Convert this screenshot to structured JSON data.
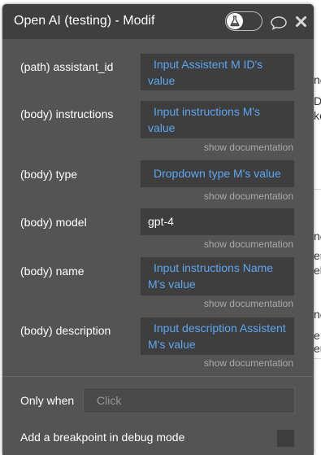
{
  "panel": {
    "title": "Open AI (testing) - Modif",
    "preview_toggle_icon": "flask-icon",
    "comment_icon": "speech-bubble-icon",
    "close_icon": "close-x-icon"
  },
  "background_fragments": [
    "ne",
    "De",
    "ke",
    "ne",
    "er",
    "ele",
    "ne",
    "e",
    "er"
  ],
  "fields": [
    {
      "label": "(path) assistant_id",
      "value_line1": "Input Assistent M ID's",
      "value_line2": "value",
      "doc": ""
    },
    {
      "label": "(body) instructions",
      "value_line1": "Input instructions M's",
      "value_line2": "value",
      "doc": "show documentation"
    },
    {
      "label": "(body) type",
      "value_line1": "Dropdown type M's value",
      "value_line2": "",
      "doc": "show documentation"
    },
    {
      "label": "(body) model",
      "value_line1": "gpt-4",
      "value_line2": "",
      "doc": "show documentation"
    },
    {
      "label": "(body) name",
      "value_line1": "Input instructions Name",
      "value_line2": "M's value",
      "doc": "show documentation"
    },
    {
      "label": "(body) description",
      "value_line1": "Input description Assistent",
      "value_line2": "M's value",
      "doc": "show documentation"
    }
  ],
  "only_when": {
    "label": "Only when",
    "placeholder": "Click"
  },
  "breakpoint": {
    "label": "Add a breakpoint in debug mode"
  }
}
